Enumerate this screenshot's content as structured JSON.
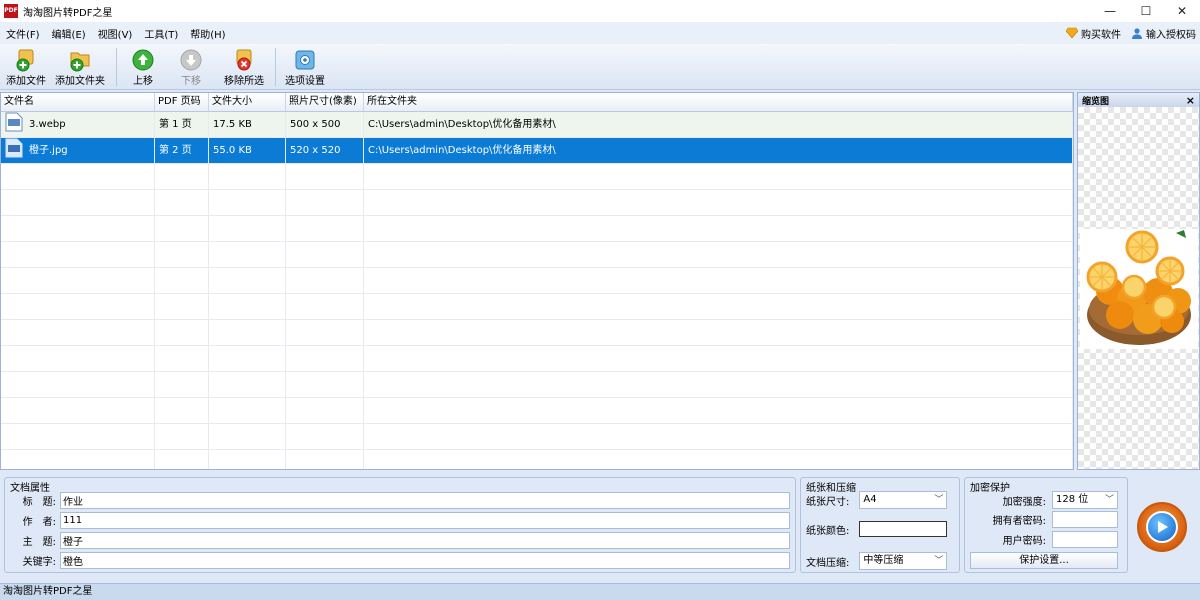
{
  "window": {
    "title": "淘淘图片转PDF之星",
    "logo_text": "PDF",
    "minimize": "—",
    "maximize": "☐",
    "close": "✕"
  },
  "menu": {
    "items": [
      "文件(F)",
      "编辑(E)",
      "视图(V)",
      "工具(T)",
      "帮助(H)"
    ],
    "buy": "购买软件",
    "license": "输入授权码"
  },
  "toolbar": {
    "add_file": "添加文件",
    "add_folder": "添加文件夹",
    "move_up": "上移",
    "move_down": "下移",
    "remove_selected": "移除所选",
    "options": "选项设置"
  },
  "file_list": {
    "headers": [
      "文件名",
      "PDF 页码",
      "文件大小",
      "照片尺寸(像素)",
      "所在文件夹"
    ],
    "rows": [
      {
        "name": "3.webp",
        "page": "第 1 页",
        "size": "17.5 KB",
        "dim": "500 x 500",
        "folder": "C:\\Users\\admin\\Desktop\\优化备用素材\\"
      },
      {
        "name": "橙子.jpg",
        "page": "第 2 页",
        "size": "55.0 KB",
        "dim": "520 x 520",
        "folder": "C:\\Users\\admin\\Desktop\\优化备用素材\\"
      }
    ]
  },
  "preview": {
    "title": "缩览图",
    "close": "×"
  },
  "doc_props": {
    "group": "文档属性",
    "title_label": "标　题:",
    "title_value": "作业",
    "author_label": "作　者:",
    "author_value": "111",
    "subject_label": "主　题:",
    "subject_value": "橙子",
    "keywords_label": "关键字:",
    "keywords_value": "橙色"
  },
  "paper": {
    "group": "纸张和压缩",
    "size_label": "纸张尺寸:",
    "size_value": "A4",
    "color_label": "纸张颜色:",
    "compress_label": "文档压缩:",
    "compress_value": "中等压缩"
  },
  "encrypt": {
    "group": "加密保护",
    "strength_label": "加密强度:",
    "strength_value": "128 位",
    "owner_label": "拥有者密码:",
    "user_label": "用户密码:",
    "settings_button": "保护设置..."
  },
  "status": {
    "text": "淘淘图片转PDF之星"
  },
  "colors": {
    "selected_row": "#0b7bd6",
    "accent_orange": "#d75f0e",
    "accent_blue": "#0e62c9"
  }
}
